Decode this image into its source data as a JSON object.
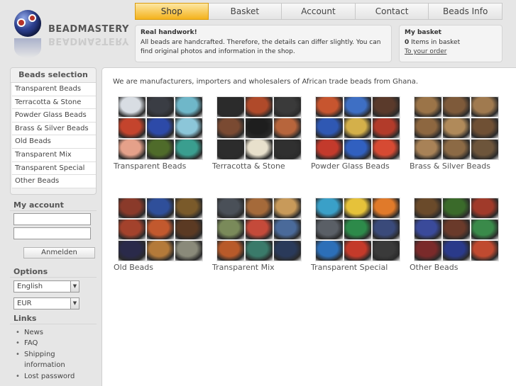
{
  "brand": {
    "name": "BEADMASTERY"
  },
  "nav": {
    "tabs": [
      "Shop",
      "Basket",
      "Account",
      "Contact",
      "Beads Info"
    ],
    "active": "Shop"
  },
  "info": {
    "title": "Real handwork!",
    "text": "All beads are handcrafted. Therefore, the details can differ slightly. You can find original photos and information in the shop."
  },
  "basket": {
    "title": "My basket",
    "count": "0",
    "count_text": "Items in basket",
    "link": "To your order"
  },
  "sidebar": {
    "beads_title": "Beads selection",
    "beads_items": [
      "Transparent Beads",
      "Terracotta & Stone",
      "Powder Glass Beads",
      "Brass & Silver Beads",
      "Old Beads",
      "Transparent Mix",
      "Transparent Special",
      "Other Beads"
    ],
    "account_title": "My account",
    "login_button": "Anmelden",
    "options_title": "Options",
    "language": "English",
    "currency": "EUR",
    "links_title": "Links",
    "links": [
      "News",
      "FAQ",
      "Shipping information",
      "Lost password"
    ]
  },
  "main": {
    "intro": "We are manufacturers, importers and wholesalers of African trade beads from Ghana.",
    "categories": [
      {
        "label": "Transparent Beads",
        "colors": [
          "#d8dde3",
          "#3a3d44",
          "#6fb7c9",
          "#c4442d",
          "#2d4aa8",
          "#8cc6d9",
          "#e5a18a",
          "#4f6b2a",
          "#3a9e8f"
        ]
      },
      {
        "label": "Terracotta & Stone",
        "colors": [
          "#2b2b2b",
          "#b04a2a",
          "#3a3a3a",
          "#7a4a32",
          "#1e1e1e",
          "#b7653c",
          "#2c2c2c",
          "#e8e0cc",
          "#303030"
        ]
      },
      {
        "label": "Powder Glass Beads",
        "colors": [
          "#c7552f",
          "#3e6fc4",
          "#5a3a2b",
          "#2f58b3",
          "#d4b04a",
          "#b23b2a",
          "#c33a2c",
          "#3160c0",
          "#d64a33"
        ]
      },
      {
        "label": "Brass & Silver Beads",
        "colors": [
          "#9b7448",
          "#7e5a3a",
          "#a07a4f",
          "#8d6740",
          "#b08a5a",
          "#6f5034",
          "#a88257",
          "#8c6a45",
          "#6d553b"
        ]
      },
      {
        "label": "Old Beads",
        "colors": [
          "#8a3a2a",
          "#2f4f9a",
          "#7a5a2a",
          "#a3422c",
          "#c2592e",
          "#5b3a23",
          "#2a2a4a",
          "#b47a3a",
          "#8a8a7a"
        ]
      },
      {
        "label": "Transparent Mix",
        "colors": [
          "#4a5058",
          "#a56a3a",
          "#c89a5a",
          "#7a8a5a",
          "#c44a3a",
          "#4a6a9a",
          "#b85a2a",
          "#3a7a6a",
          "#2a3a5a"
        ]
      },
      {
        "label": "Transparent Special",
        "colors": [
          "#3aa0c8",
          "#e6c23a",
          "#e07a2a",
          "#5a5f66",
          "#2d8a4a",
          "#3a4a7a",
          "#2c6fb8",
          "#c43a2a",
          "#3a3a3a"
        ]
      },
      {
        "label": "Other Beads",
        "colors": [
          "#6a4a2a",
          "#3a6a2a",
          "#a03a2a",
          "#3a4a9a",
          "#6a3a2a",
          "#3a8a4a",
          "#7a2a2a",
          "#2a3a8a",
          "#c04a30"
        ]
      }
    ]
  }
}
